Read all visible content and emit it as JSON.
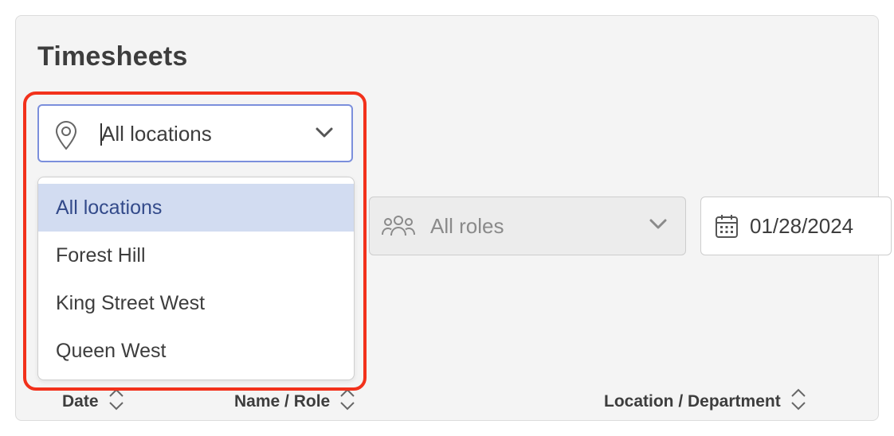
{
  "page": {
    "title": "Timesheets"
  },
  "filters": {
    "location": {
      "value": "All locations",
      "options": [
        "All locations",
        "Forest Hill",
        "King Street West",
        "Queen West"
      ],
      "selected_index": 0
    },
    "roles": {
      "value": "All roles"
    },
    "date": {
      "value": "01/28/2024"
    }
  },
  "table": {
    "columns": [
      "Date",
      "Name / Role",
      "Location / Department"
    ]
  },
  "colors": {
    "highlight": "#f2311b",
    "selected_option_bg": "#d2dcf1",
    "focus_border": "#7b8fdc"
  },
  "icons": [
    "location-pin-icon",
    "chevron-down-icon",
    "people-icon",
    "calendar-icon",
    "sort-icon"
  ]
}
